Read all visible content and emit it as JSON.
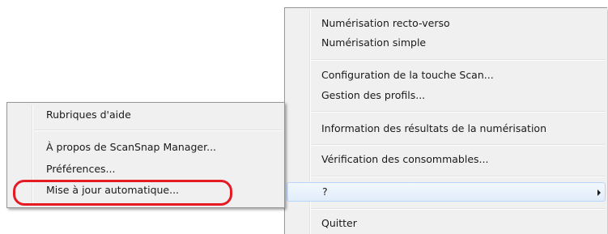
{
  "main_menu": {
    "items": [
      {
        "label": "Numérisation recto-verso"
      },
      {
        "label": "Numérisation simple"
      },
      {
        "label": "Configuration de la touche Scan..."
      },
      {
        "label": "Gestion des profils..."
      },
      {
        "label": "Information des résultats de la numérisation"
      },
      {
        "label": "Vérification des consommables..."
      },
      {
        "label": "?"
      },
      {
        "label": "Quitter"
      }
    ]
  },
  "help_submenu": {
    "items": [
      {
        "label": "Rubriques d'aide"
      },
      {
        "label": "À propos de ScanSnap Manager..."
      },
      {
        "label": "Préférences..."
      },
      {
        "label": "Mise à jour automatique..."
      }
    ]
  },
  "annotation": {
    "ring_color": "#e41b23"
  }
}
